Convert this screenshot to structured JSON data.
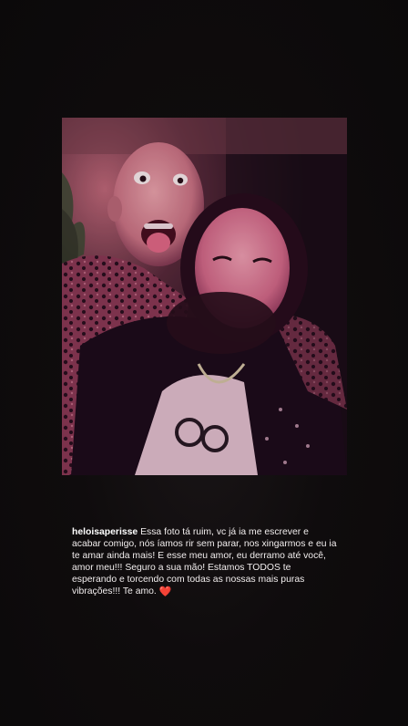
{
  "post": {
    "username": "heloisaperisse",
    "caption": "Essa foto tá ruim, vc já ia me escrever e acabar comigo, nós íamos rir sem parar, nos xingarmos e eu ia te amar ainda mais! E esse meu amor, eu derramo até você, amor meu!!! Seguro a sua mão! Estamos TODOS te esperando e torcendo com todas as nossas mais puras vibrações!!! Te amo.",
    "emoji": "❤️",
    "emoji_icon": "red-heart-icon"
  },
  "colors": {
    "background": "#0d0b0c",
    "caption_text": "#f2eeee",
    "heart": "#e8334a"
  }
}
